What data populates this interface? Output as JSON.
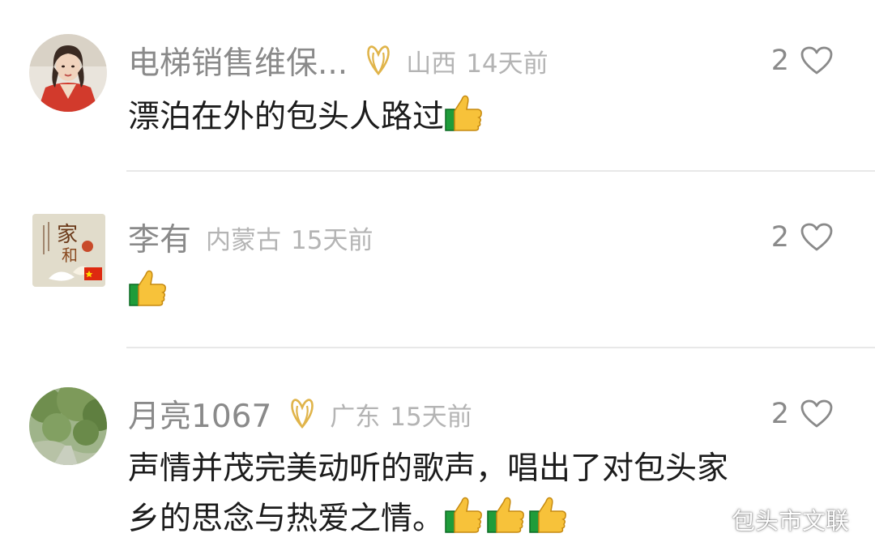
{
  "comments": [
    {
      "username": "电梯销售维保...",
      "has_badge": true,
      "location": "山西",
      "time": "14天前",
      "likes": "2",
      "text": "漂泊在外的包头人路过",
      "thumbs": 1
    },
    {
      "username": "李有",
      "has_badge": false,
      "location": "内蒙古",
      "time": "15天前",
      "likes": "2",
      "text": "",
      "thumbs": 1
    },
    {
      "username": "月亮1067",
      "has_badge": true,
      "location": "广东",
      "time": "15天前",
      "likes": "2",
      "text_line1": "声情并茂完美动听的歌声，唱出了对包头家",
      "text_line2": "乡的思念与热爱之情。",
      "thumbs": 3
    }
  ],
  "watermark": {
    "text": "包头市文联",
    "icon": "wechat-icon"
  },
  "colors": {
    "username": "#8a8a8a",
    "meta": "#b4b4b4",
    "text": "#1c1c1c",
    "badge": "#e0b44a",
    "divider": "#e8e8e8"
  }
}
